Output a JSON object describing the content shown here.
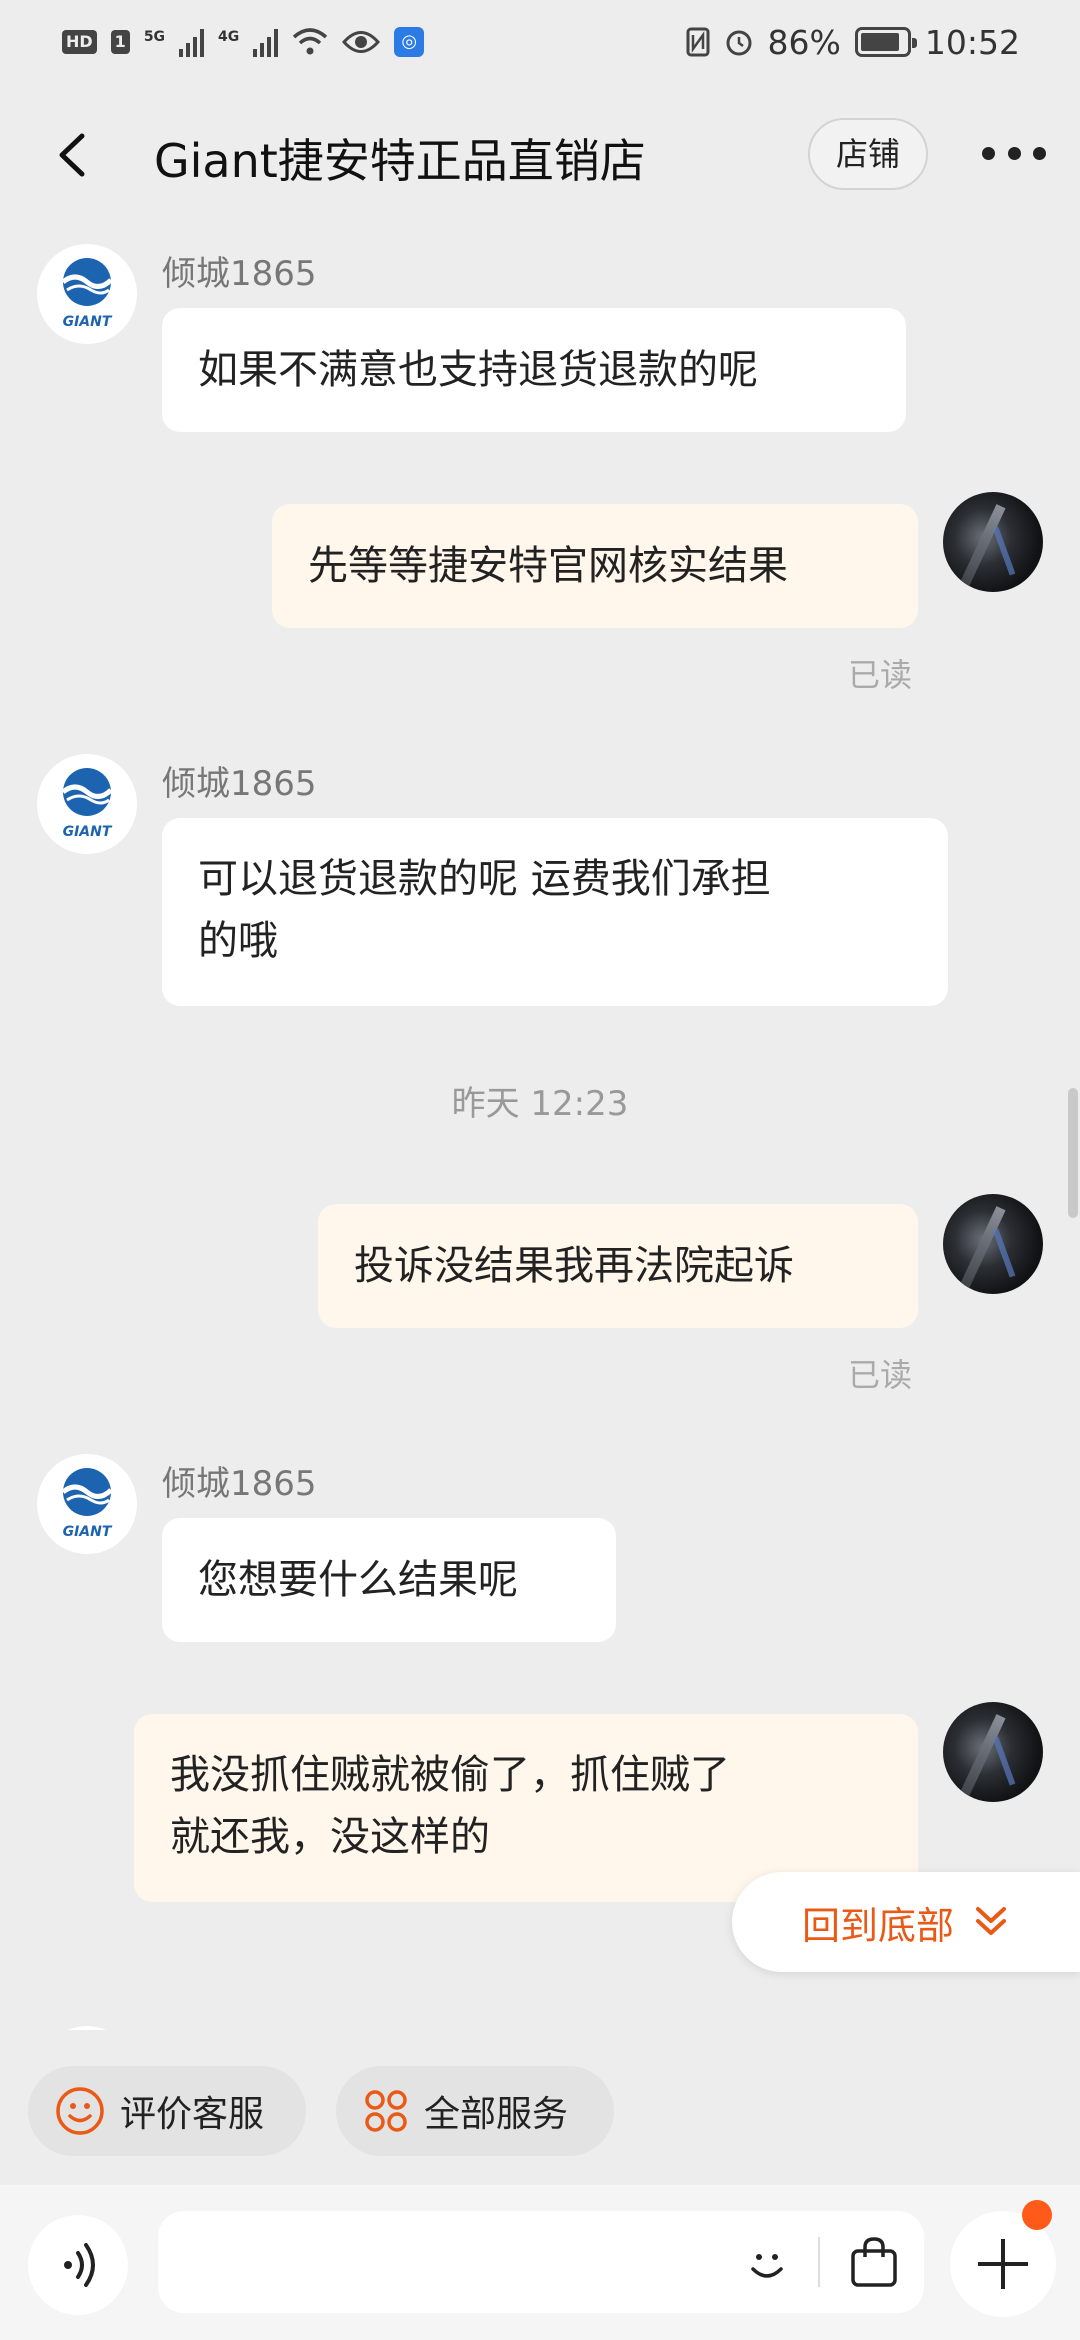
{
  "status_bar": {
    "hd_badge": "HD",
    "sim_badge": "1",
    "net1": "5G",
    "net2": "4G",
    "battery_percent": "86%",
    "battery_level": 0.86,
    "time": "10:52"
  },
  "header": {
    "title": "Giant捷安特正品直销店",
    "shop_label": "店铺"
  },
  "merchant": {
    "name": "倾城1865",
    "logo_text": "GIANT"
  },
  "messages": [
    {
      "from": "merchant",
      "sender": "倾城1865",
      "text": "如果不满意也支持退货退款的呢"
    },
    {
      "from": "user",
      "text": "先等等捷安特官网核实结果",
      "status": "已读"
    },
    {
      "from": "merchant",
      "sender": "倾城1865",
      "lines": [
        "可以退货退款的呢 运费我们承担",
        "的哦"
      ]
    },
    {
      "from": "user",
      "text": "投诉没结果我再法院起诉",
      "status": "已读"
    },
    {
      "from": "merchant",
      "sender": "倾城1865",
      "text": "您想要什么结果呢"
    },
    {
      "from": "user",
      "lines": [
        "我没抓住贼就被偷了，抓住贼了",
        "就还我，没这样的"
      ]
    }
  ],
  "timestamp": "昨天  12:23",
  "back_to_bottom": "回到底部",
  "quick_actions": {
    "rate": "评价客服",
    "all_services": "全部服务"
  },
  "input": {
    "placeholder": ""
  },
  "colors": {
    "accent": "#ea5a16",
    "outgoing_bubble": "#fff6ec",
    "incoming_bubble": "#ffffff",
    "background": "#ededed",
    "giant_blue": "#1d64b0"
  }
}
